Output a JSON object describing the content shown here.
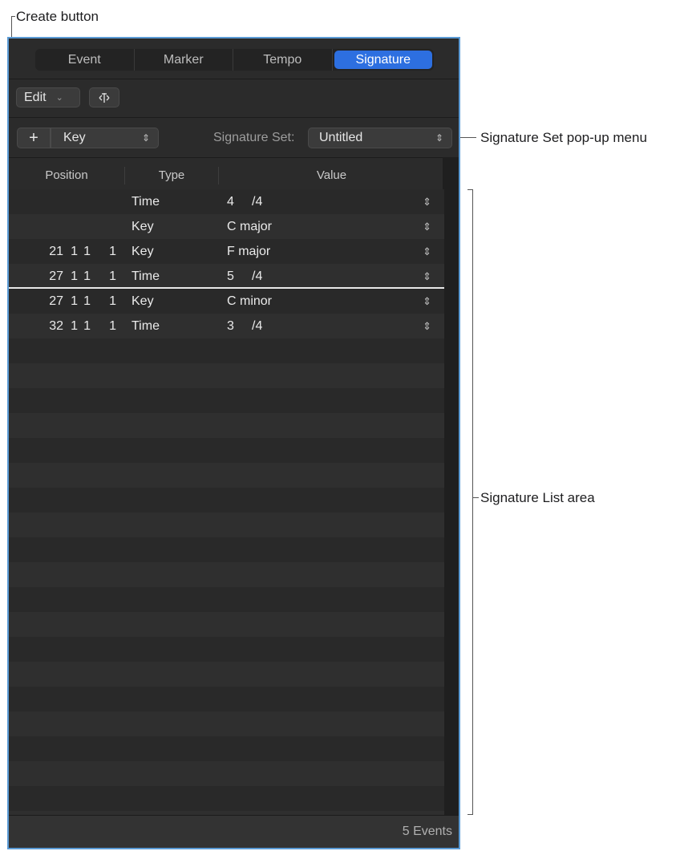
{
  "callouts": {
    "create_button": "Create button",
    "signature_set_menu": "Signature Set pop-up menu",
    "signature_list_area": "Signature List area"
  },
  "tabs": [
    {
      "label": "Event"
    },
    {
      "label": "Marker"
    },
    {
      "label": "Tempo"
    },
    {
      "label": "Signature",
      "active": true
    }
  ],
  "toolbar": {
    "edit_label": "Edit",
    "create_type": "Key",
    "signature_set_label": "Signature Set:",
    "signature_set_value": "Untitled"
  },
  "columns": {
    "position": "Position",
    "type": "Type",
    "value": "Value"
  },
  "rows": [
    {
      "bar": "",
      "beat": "",
      "div": "",
      "tick": "",
      "type": "Time",
      "value_a": "4",
      "value_b": "/4"
    },
    {
      "bar": "",
      "beat": "",
      "div": "",
      "tick": "",
      "type": "Key",
      "value_a": "C major",
      "value_b": ""
    },
    {
      "bar": "21",
      "beat": "1",
      "div": "1",
      "tick": "1",
      "type": "Key",
      "value_a": "F major",
      "value_b": ""
    },
    {
      "bar": "27",
      "beat": "1",
      "div": "1",
      "tick": "1",
      "type": "Time",
      "value_a": "5",
      "value_b": "/4"
    },
    {
      "bar": "27",
      "beat": "1",
      "div": "1",
      "tick": "1",
      "type": "Key",
      "value_a": "C minor",
      "value_b": ""
    },
    {
      "bar": "32",
      "beat": "1",
      "div": "1",
      "tick": "1",
      "type": "Time",
      "value_a": "3",
      "value_b": "/4"
    }
  ],
  "footer": {
    "event_count": "5 Events"
  },
  "colors": {
    "accent": "#2d6fe0",
    "panel_border": "#5b9bd5",
    "background": "#2b2b2b"
  }
}
